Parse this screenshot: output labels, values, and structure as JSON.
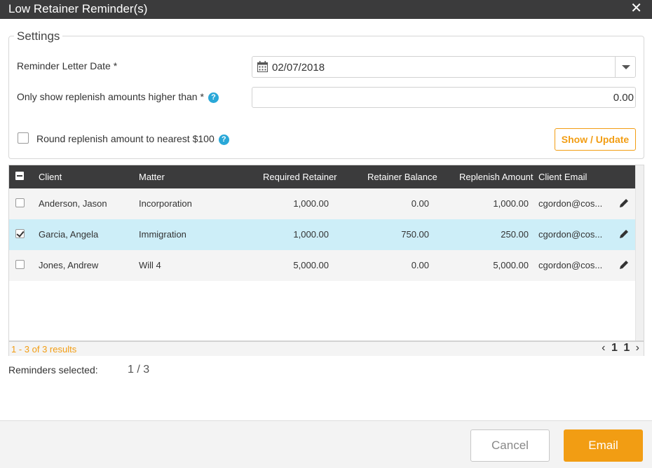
{
  "dialog": {
    "title": "Low Retainer Reminder(s)",
    "close_icon": "close-icon"
  },
  "settings": {
    "legend": "Settings",
    "date_label": "Reminder Letter Date *",
    "date_value": "02/07/2018",
    "amount_label": "Only show replenish amounts higher than *",
    "amount_value": "0.00",
    "round_label": "Round replenish amount to nearest $100",
    "round_checked": false,
    "show_update_label": "Show / Update"
  },
  "grid": {
    "headers": {
      "client": "Client",
      "matter": "Matter",
      "required": "Required Retainer",
      "balance": "Retainer Balance",
      "replenish": "Replenish Amount",
      "email": "Client Email"
    },
    "rows": [
      {
        "client": "Anderson, Jason",
        "matter": "Incorporation",
        "required": "1,000.00",
        "balance": "0.00",
        "replenish": "1,000.00",
        "email": "cgordon@cos...",
        "checked": false
      },
      {
        "client": "Garcia, Angela",
        "matter": "Immigration",
        "required": "1,000.00",
        "balance": "750.00",
        "replenish": "250.00",
        "email": "cgordon@cos...",
        "checked": true
      },
      {
        "client": "Jones, Andrew",
        "matter": "Will 4",
        "required": "5,000.00",
        "balance": "0.00",
        "replenish": "5,000.00",
        "email": "cgordon@cos...",
        "checked": false
      }
    ],
    "results_text": "1 - 3 of 3 results",
    "pager": {
      "prev": "‹",
      "page": "1",
      "total": "1",
      "next": "›"
    }
  },
  "reminders": {
    "label": "Reminders selected:",
    "value": "1 / 3"
  },
  "footer": {
    "cancel_label": "Cancel",
    "email_label": "Email"
  },
  "colors": {
    "accent": "#f29d13",
    "header_bg": "#3b3b3c",
    "selected_row": "#cdeef8",
    "help": "#2aa8d8"
  }
}
